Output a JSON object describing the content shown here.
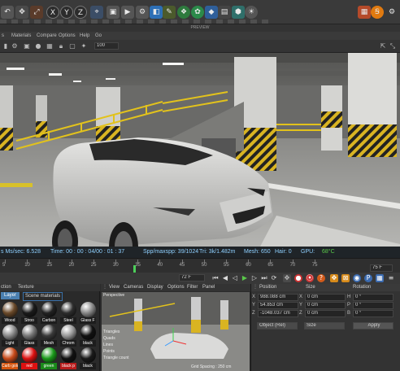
{
  "window": {
    "title": "PREVIEW"
  },
  "toolbar": {
    "axis_x": "X",
    "axis_y": "Y",
    "axis_z": "Z",
    "icons": [
      "undo-icon",
      "move-icon",
      "x-axis-icon",
      "y-axis-icon",
      "z-axis-icon",
      "world-icon",
      "render-icon",
      "render-settings-icon",
      "cube-icon",
      "pen-icon",
      "deformer-icon",
      "generator-icon",
      "environment-icon",
      "camera-icon",
      "light-icon",
      "bulb-icon",
      "render-preview-icon",
      "material-icon"
    ]
  },
  "menu": {
    "items": [
      "s",
      "Materials",
      "Compare",
      "Options",
      "Help",
      "Go"
    ]
  },
  "viewport_icons": {
    "dropdown": "100"
  },
  "status": {
    "ms_sec": "s Ms/sec: 6.528",
    "time": "Time: 00 : 00 : 04/00 : 01 : 37",
    "spp": "Spp/maxspp: 39/1024",
    "tri": "Tri: 3k/1.482m",
    "mesh": "Mesh: 650",
    "hair": "Hair: 0",
    "gpu_label": "GPU:",
    "gpu_temp": "68°C"
  },
  "timeline": {
    "ticks": [
      "5",
      "10",
      "15",
      "20",
      "25",
      "30",
      "35",
      "40",
      "45",
      "50",
      "55",
      "60",
      "65",
      "70",
      "75"
    ],
    "frame_right": "75 F"
  },
  "transport": {
    "frame_field": "72 F"
  },
  "materials": {
    "tabs": [
      "ction",
      "Texture"
    ],
    "filter": [
      "Layer",
      "Scene materials"
    ],
    "items": [
      {
        "label": "Wood",
        "color": "#6b4a2a"
      },
      {
        "label": "Stroo",
        "color": "#1a1a1a"
      },
      {
        "label": "Carbon",
        "color": "#222"
      },
      {
        "label": "Steel",
        "color": "#2d2d2d"
      },
      {
        "label": "Glass F",
        "color": "#888"
      },
      {
        "label": "Light",
        "color": "#8a8a8a"
      },
      {
        "label": "Glass",
        "color": "#777"
      },
      {
        "label": "Mesh",
        "color": "#3a3a3a"
      },
      {
        "label": "Chrom",
        "color": "#999"
      },
      {
        "label": "black",
        "color": "#111"
      },
      {
        "label": "Carb gold",
        "color": "#c84a1a"
      },
      {
        "label": "red",
        "color": "#d11"
      },
      {
        "label": "green",
        "color": "#1a9a1a"
      },
      {
        "label": "black p",
        "color": "#111"
      },
      {
        "label": "black",
        "color": "#1a1a1a"
      }
    ],
    "label_colors": {
      "Carb gold": "#d4540e",
      "red": "#d11",
      "green": "#1a8a1a",
      "black p": "#b81c1c"
    }
  },
  "preview": {
    "menu": [
      "View",
      "Cameras",
      "Display",
      "Options",
      "Filter",
      "Panel"
    ],
    "mode": "Perspective",
    "stats": [
      "Triangles",
      "Quads",
      "Lines",
      "Points",
      "Triangle count"
    ],
    "footer": "Grid Spacing : 250 cm"
  },
  "attributes": {
    "headers": {
      "position": "Position",
      "size": "Size",
      "rotation": "Rotation"
    },
    "rows": [
      {
        "axis": "X",
        "pos": "988.088 cm",
        "size_axis": "X",
        "size": "0 cm",
        "rot_axis": "H",
        "rot": "0 °"
      },
      {
        "axis": "Y",
        "pos": "54.853 cm",
        "size_axis": "Y",
        "size": "0 cm",
        "rot_axis": "P",
        "rot": "0 °"
      },
      {
        "axis": "Z",
        "pos": "-1048.037 cm",
        "size_axis": "Z",
        "size": "0 cm",
        "rot_axis": "B",
        "rot": "0 °"
      }
    ],
    "coord_mode": "Object (Rel)",
    "size_mode": "Size",
    "apply": "Apply"
  },
  "colors": {
    "accent": "#4a7fb0",
    "gpu_ok": "#5ac84a",
    "status_time": "#8fd0ff"
  }
}
